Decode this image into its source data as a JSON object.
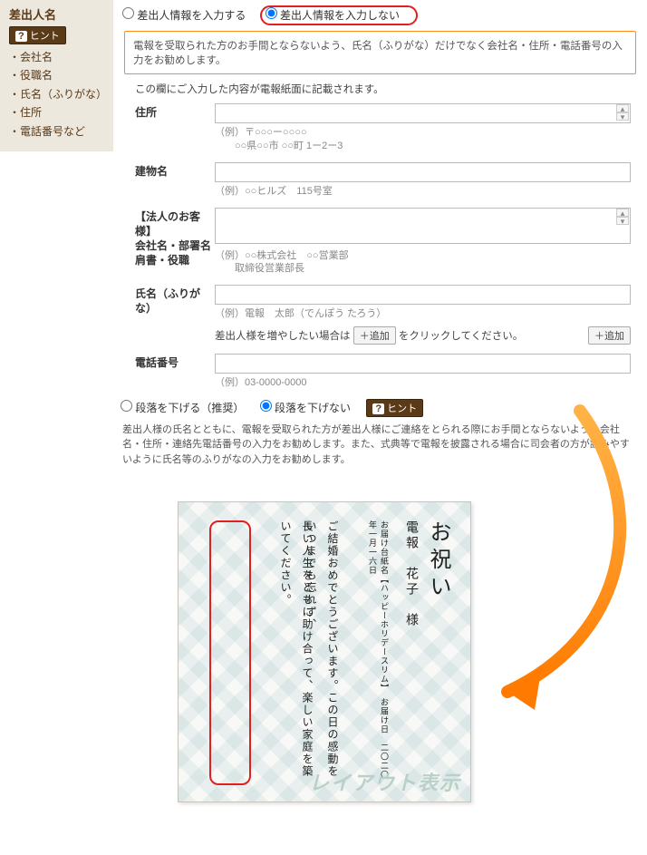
{
  "sidebar": {
    "title": "差出人名",
    "hint_label": "ヒント",
    "items": [
      "・会社名",
      "・役職名",
      "・氏名（ふりがな）",
      "・住所",
      "・電話番号など"
    ]
  },
  "sender_radio": {
    "opt_input": "差出人情報を入力する",
    "opt_noinput": "差出人情報を入力しない"
  },
  "orange_note": "電報を受取られた方のお手間とならないよう、氏名（ふりがな）だけでなく会社名・住所・電話番号の入力をお勧めします。",
  "lead": "この欄にご入力した内容が電報紙面に記載されます。",
  "fields": {
    "address": {
      "label": "住所",
      "eg1": "（例）〒○○○ー○○○○",
      "eg2": "○○県○○市 ○○町 1ー2ー3"
    },
    "building": {
      "label": "建物名",
      "eg": "（例）○○ヒルズ　115号室"
    },
    "company": {
      "label1": "【法人のお客様】",
      "label2": "会社名・部署名",
      "label3": "肩書・役職",
      "eg1": "（例）○○株式会社　○○営業部",
      "eg2": "取締役営業部長"
    },
    "name": {
      "label": "氏名（ふりがな）",
      "eg": "（例）電報　太郎（でんぽう たろう）",
      "add_lead": "差出人様を増やしたい場合は",
      "add_mid": "をクリックしてください。",
      "add_btn": "＋追加"
    },
    "tel": {
      "label": "電話番号",
      "eg": "（例）03-0000-0000"
    }
  },
  "dandan": {
    "opt_down": "段落を下げる（推奨）",
    "opt_nodown": "段落を下げない",
    "hint_label": "ヒント"
  },
  "foot_note": "差出人様の氏名とともに、電報を受取られた方が差出人様にご連絡をとられる際にお手間とならないよう、会社名・住所・連絡先電話番号の入力をお勧めします。また、式典等で電報を披露される場合に司会者の方が読みやすいように氏名等のふりがなの入力をお勧めします。",
  "preview": {
    "title": "お祝い",
    "recipient": "電報　花子　様",
    "meta1": "お届け台紙名【ハッピーホリデースリム】",
    "meta2": "お届け日　二〇二〇年一月一六日",
    "body1": "ご結婚おめでとうございます。この日の感動をいつまでも忘れず、",
    "body2": "長い人生をともに助け合って、楽しい家庭を築いてください。",
    "watermark": "レイアウト表示"
  }
}
